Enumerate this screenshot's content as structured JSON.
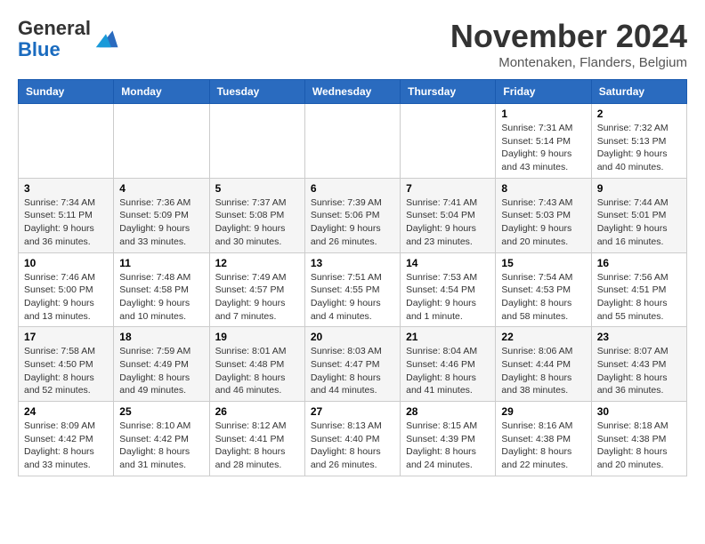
{
  "header": {
    "logo_general": "General",
    "logo_blue": "Blue",
    "month_title": "November 2024",
    "location": "Montenaken, Flanders, Belgium"
  },
  "days_of_week": [
    "Sunday",
    "Monday",
    "Tuesday",
    "Wednesday",
    "Thursday",
    "Friday",
    "Saturday"
  ],
  "weeks": [
    [
      {
        "day": "",
        "detail": ""
      },
      {
        "day": "",
        "detail": ""
      },
      {
        "day": "",
        "detail": ""
      },
      {
        "day": "",
        "detail": ""
      },
      {
        "day": "",
        "detail": ""
      },
      {
        "day": "1",
        "detail": "Sunrise: 7:31 AM\nSunset: 5:14 PM\nDaylight: 9 hours and 43 minutes."
      },
      {
        "day": "2",
        "detail": "Sunrise: 7:32 AM\nSunset: 5:13 PM\nDaylight: 9 hours and 40 minutes."
      }
    ],
    [
      {
        "day": "3",
        "detail": "Sunrise: 7:34 AM\nSunset: 5:11 PM\nDaylight: 9 hours and 36 minutes."
      },
      {
        "day": "4",
        "detail": "Sunrise: 7:36 AM\nSunset: 5:09 PM\nDaylight: 9 hours and 33 minutes."
      },
      {
        "day": "5",
        "detail": "Sunrise: 7:37 AM\nSunset: 5:08 PM\nDaylight: 9 hours and 30 minutes."
      },
      {
        "day": "6",
        "detail": "Sunrise: 7:39 AM\nSunset: 5:06 PM\nDaylight: 9 hours and 26 minutes."
      },
      {
        "day": "7",
        "detail": "Sunrise: 7:41 AM\nSunset: 5:04 PM\nDaylight: 9 hours and 23 minutes."
      },
      {
        "day": "8",
        "detail": "Sunrise: 7:43 AM\nSunset: 5:03 PM\nDaylight: 9 hours and 20 minutes."
      },
      {
        "day": "9",
        "detail": "Sunrise: 7:44 AM\nSunset: 5:01 PM\nDaylight: 9 hours and 16 minutes."
      }
    ],
    [
      {
        "day": "10",
        "detail": "Sunrise: 7:46 AM\nSunset: 5:00 PM\nDaylight: 9 hours and 13 minutes."
      },
      {
        "day": "11",
        "detail": "Sunrise: 7:48 AM\nSunset: 4:58 PM\nDaylight: 9 hours and 10 minutes."
      },
      {
        "day": "12",
        "detail": "Sunrise: 7:49 AM\nSunset: 4:57 PM\nDaylight: 9 hours and 7 minutes."
      },
      {
        "day": "13",
        "detail": "Sunrise: 7:51 AM\nSunset: 4:55 PM\nDaylight: 9 hours and 4 minutes."
      },
      {
        "day": "14",
        "detail": "Sunrise: 7:53 AM\nSunset: 4:54 PM\nDaylight: 9 hours and 1 minute."
      },
      {
        "day": "15",
        "detail": "Sunrise: 7:54 AM\nSunset: 4:53 PM\nDaylight: 8 hours and 58 minutes."
      },
      {
        "day": "16",
        "detail": "Sunrise: 7:56 AM\nSunset: 4:51 PM\nDaylight: 8 hours and 55 minutes."
      }
    ],
    [
      {
        "day": "17",
        "detail": "Sunrise: 7:58 AM\nSunset: 4:50 PM\nDaylight: 8 hours and 52 minutes."
      },
      {
        "day": "18",
        "detail": "Sunrise: 7:59 AM\nSunset: 4:49 PM\nDaylight: 8 hours and 49 minutes."
      },
      {
        "day": "19",
        "detail": "Sunrise: 8:01 AM\nSunset: 4:48 PM\nDaylight: 8 hours and 46 minutes."
      },
      {
        "day": "20",
        "detail": "Sunrise: 8:03 AM\nSunset: 4:47 PM\nDaylight: 8 hours and 44 minutes."
      },
      {
        "day": "21",
        "detail": "Sunrise: 8:04 AM\nSunset: 4:46 PM\nDaylight: 8 hours and 41 minutes."
      },
      {
        "day": "22",
        "detail": "Sunrise: 8:06 AM\nSunset: 4:44 PM\nDaylight: 8 hours and 38 minutes."
      },
      {
        "day": "23",
        "detail": "Sunrise: 8:07 AM\nSunset: 4:43 PM\nDaylight: 8 hours and 36 minutes."
      }
    ],
    [
      {
        "day": "24",
        "detail": "Sunrise: 8:09 AM\nSunset: 4:42 PM\nDaylight: 8 hours and 33 minutes."
      },
      {
        "day": "25",
        "detail": "Sunrise: 8:10 AM\nSunset: 4:42 PM\nDaylight: 8 hours and 31 minutes."
      },
      {
        "day": "26",
        "detail": "Sunrise: 8:12 AM\nSunset: 4:41 PM\nDaylight: 8 hours and 28 minutes."
      },
      {
        "day": "27",
        "detail": "Sunrise: 8:13 AM\nSunset: 4:40 PM\nDaylight: 8 hours and 26 minutes."
      },
      {
        "day": "28",
        "detail": "Sunrise: 8:15 AM\nSunset: 4:39 PM\nDaylight: 8 hours and 24 minutes."
      },
      {
        "day": "29",
        "detail": "Sunrise: 8:16 AM\nSunset: 4:38 PM\nDaylight: 8 hours and 22 minutes."
      },
      {
        "day": "30",
        "detail": "Sunrise: 8:18 AM\nSunset: 4:38 PM\nDaylight: 8 hours and 20 minutes."
      }
    ]
  ]
}
